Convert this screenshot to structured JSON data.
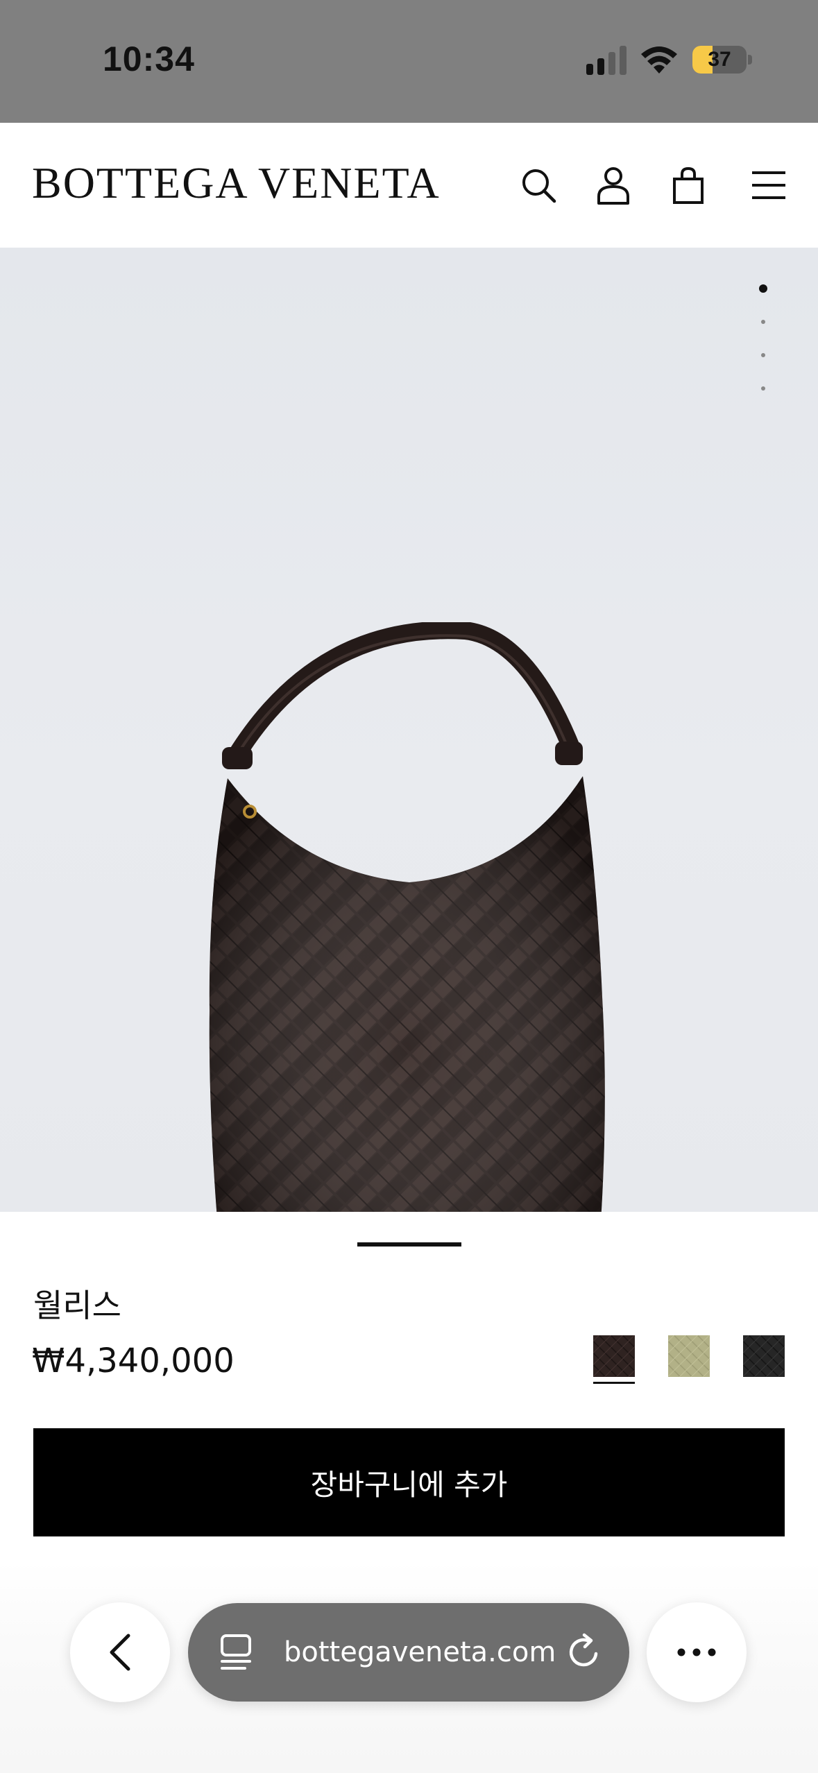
{
  "status_bar": {
    "time": "10:34",
    "battery_percent": "37",
    "battery_level": 0.37,
    "signal_bars_active": 2,
    "signal_bars_total": 4
  },
  "header": {
    "brand": "BOTTEGA VENETA",
    "icons": [
      "search-icon",
      "account-icon",
      "shopping-bag-icon",
      "menu-icon"
    ]
  },
  "gallery": {
    "image_count": 4,
    "active_index": 0
  },
  "product": {
    "name": "월리스",
    "price": "₩4,340,000",
    "swatches": [
      {
        "color": "#2f2321",
        "selected": true
      },
      {
        "color": "#b2b187",
        "selected": false
      },
      {
        "color": "#262626",
        "selected": false
      }
    ],
    "add_to_cart_label": "장바구니에 추가"
  },
  "browser": {
    "url": "bottegaveneta.com",
    "icons": [
      "back-icon",
      "tabs-icon",
      "reload-icon",
      "more-icon"
    ]
  },
  "colors": {
    "status_bar_bg": "#808080",
    "battery_accent": "#f7c948",
    "button_bg": "#000000",
    "url_bar_bg": "#6e6e6e"
  }
}
